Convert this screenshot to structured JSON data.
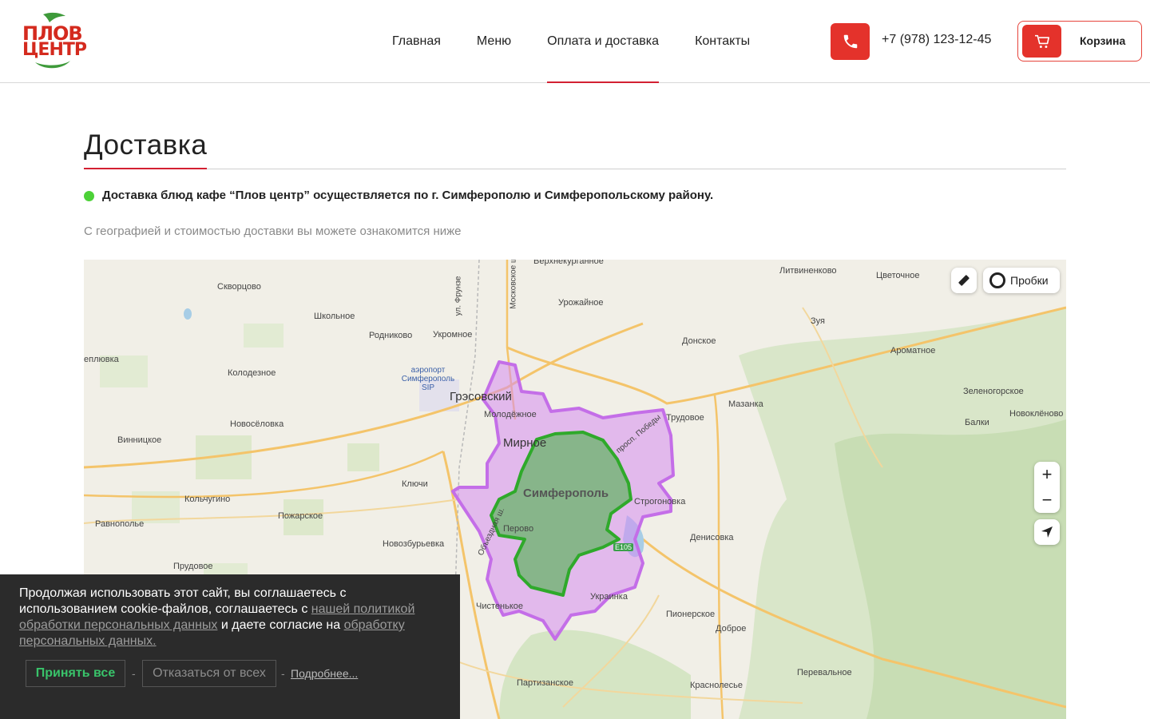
{
  "brand": {
    "logo_line1": "ПЛОВ",
    "logo_line2": "ЦЕНТР",
    "logo_icon": "plov-centr-logo",
    "accent_color": "#d32032",
    "button_color": "#e4322b"
  },
  "nav": {
    "items": [
      {
        "label": "Главная",
        "active": false
      },
      {
        "label": "Меню",
        "active": false
      },
      {
        "label": "Оплата и доставка",
        "active": true
      },
      {
        "label": "Контакты",
        "active": false
      }
    ]
  },
  "header": {
    "phone_icon": "phone-icon",
    "phone": "+7 (978) 123-12-45",
    "cart_icon": "cart-icon",
    "cart_label": "Корзина"
  },
  "page": {
    "title": "Доставка",
    "info": "Доставка блюд кафе “Плов центр” осуществляется по г. Симферополю и Симферопольскому району.",
    "subinfo": "С географией и стоимостью доставки вы можете ознакомится ниже"
  },
  "map": {
    "traffic_label": "Пробки",
    "ruler_icon": "ruler-icon",
    "zoom_in": "+",
    "zoom_out": "−",
    "locate_icon": "locate-icon",
    "zone_outer_color": "#d58cf0",
    "zone_inner_color": "#3db33a",
    "places": [
      {
        "name": "Скворцово"
      },
      {
        "name": "Школьное"
      },
      {
        "name": "Родниково"
      },
      {
        "name": "Укромное"
      },
      {
        "name": "Урожайное"
      },
      {
        "name": "Литвиненково"
      },
      {
        "name": "Цветочное"
      },
      {
        "name": "Зуя"
      },
      {
        "name": "Ароматное"
      },
      {
        "name": "Донское"
      },
      {
        "name": "Колодезное"
      },
      {
        "name": "еплювка"
      },
      {
        "name": "аэропорт Симферополь SIP"
      },
      {
        "name": "Грэсовский"
      },
      {
        "name": "Молодёжное"
      },
      {
        "name": "Трудовое"
      },
      {
        "name": "Мазанка"
      },
      {
        "name": "Зеленогорское"
      },
      {
        "name": "Балки"
      },
      {
        "name": "Новоклёново"
      },
      {
        "name": "Новосёловка"
      },
      {
        "name": "Винницкое"
      },
      {
        "name": "Мирное"
      },
      {
        "name": "Симферополь"
      },
      {
        "name": "Ключи"
      },
      {
        "name": "Кольчугино"
      },
      {
        "name": "Строгоновка"
      },
      {
        "name": "Равнополье"
      },
      {
        "name": "Пожарское"
      },
      {
        "name": "Перово"
      },
      {
        "name": "Денисовка"
      },
      {
        "name": "Новозбурьевка"
      },
      {
        "name": "Прудовое"
      },
      {
        "name": "Украинка"
      },
      {
        "name": "Чистенькое"
      },
      {
        "name": "Пионерское"
      },
      {
        "name": "Доброе"
      },
      {
        "name": "Перевальное"
      },
      {
        "name": "Партизанское"
      },
      {
        "name": "Краснолесье"
      },
      {
        "name": "Верхнекурганное"
      },
      {
        "name": "ул. Фрунзе"
      },
      {
        "name": "Московское ш."
      },
      {
        "name": "просп. Победы"
      },
      {
        "name": "Объездная ш."
      },
      {
        "name": "Е105"
      }
    ]
  },
  "cookie": {
    "text_1": "Продолжая использовать этот сайт, вы соглашаетесь с использованием cookie-файлов, соглашаетесь с ",
    "link_1": "нашей политикой обработки персональных данных",
    "text_2": " и даете согласие на ",
    "link_2": "обработку персональных данных.",
    "accept": "Принять все",
    "reject": "Отказаться от всех",
    "more": "Подробнее...",
    "sep": "-",
    "accept_color": "#39c36a"
  }
}
